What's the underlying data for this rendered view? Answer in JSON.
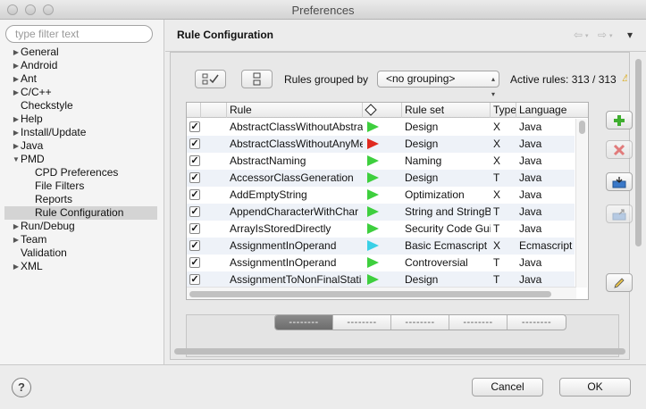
{
  "window": {
    "title": "Preferences"
  },
  "filter": {
    "placeholder": "type filter text",
    "value": ""
  },
  "tree": [
    {
      "label": "General",
      "indent": 0,
      "arrow": "right"
    },
    {
      "label": "Android",
      "indent": 0,
      "arrow": "right"
    },
    {
      "label": "Ant",
      "indent": 0,
      "arrow": "right"
    },
    {
      "label": "C/C++",
      "indent": 0,
      "arrow": "right"
    },
    {
      "label": "Checkstyle",
      "indent": 0,
      "arrow": "none"
    },
    {
      "label": "Help",
      "indent": 0,
      "arrow": "right"
    },
    {
      "label": "Install/Update",
      "indent": 0,
      "arrow": "right"
    },
    {
      "label": "Java",
      "indent": 0,
      "arrow": "right"
    },
    {
      "label": "PMD",
      "indent": 0,
      "arrow": "down"
    },
    {
      "label": "CPD Preferences",
      "indent": 1,
      "arrow": "none"
    },
    {
      "label": "File Filters",
      "indent": 1,
      "arrow": "none"
    },
    {
      "label": "Reports",
      "indent": 1,
      "arrow": "none"
    },
    {
      "label": "Rule Configuration",
      "indent": 1,
      "arrow": "none",
      "selected": true
    },
    {
      "label": "Run/Debug",
      "indent": 0,
      "arrow": "right"
    },
    {
      "label": "Team",
      "indent": 0,
      "arrow": "right"
    },
    {
      "label": "Validation",
      "indent": 0,
      "arrow": "none"
    },
    {
      "label": "XML",
      "indent": 0,
      "arrow": "right"
    }
  ],
  "page": {
    "title": "Rule Configuration",
    "nav_back": "⇦",
    "nav_forward": "⇨",
    "menu": "▾"
  },
  "toolbar": {
    "grouped_label": "Rules grouped by",
    "grouping_value": "<no grouping>",
    "active_rules": "Active rules: 313 / 313"
  },
  "table": {
    "columns": [
      "Rule",
      "Rule set",
      "Type",
      "Language"
    ],
    "rows": [
      {
        "checked": true,
        "rule": "AbstractClassWithoutAbstra",
        "priority_color": "#3ecf3e",
        "ruleset": "Design",
        "type": "X",
        "language": "Java"
      },
      {
        "checked": true,
        "rule": "AbstractClassWithoutAnyMe",
        "priority_color": "#e02a1f",
        "ruleset": "Design",
        "type": "X",
        "language": "Java"
      },
      {
        "checked": true,
        "rule": "AbstractNaming",
        "priority_color": "#3ecf3e",
        "ruleset": "Naming",
        "type": "X",
        "language": "Java"
      },
      {
        "checked": true,
        "rule": "AccessorClassGeneration",
        "priority_color": "#3ecf3e",
        "ruleset": "Design",
        "type": "T",
        "language": "Java"
      },
      {
        "checked": true,
        "rule": "AddEmptyString",
        "priority_color": "#3ecf3e",
        "ruleset": "Optimization",
        "type": "X",
        "language": "Java"
      },
      {
        "checked": true,
        "rule": "AppendCharacterWithChar",
        "priority_color": "#3ecf3e",
        "ruleset": "String and StringB",
        "type": "T",
        "language": "Java"
      },
      {
        "checked": true,
        "rule": "ArrayIsStoredDirectly",
        "priority_color": "#3ecf3e",
        "ruleset": "Security Code Gui",
        "type": "T",
        "language": "Java"
      },
      {
        "checked": true,
        "rule": "AssignmentInOperand",
        "priority_color": "#3ad0e6",
        "ruleset": "Basic Ecmascript",
        "type": "X",
        "language": "Ecmascript"
      },
      {
        "checked": true,
        "rule": "AssignmentInOperand",
        "priority_color": "#3ecf3e",
        "ruleset": "Controversial",
        "type": "T",
        "language": "Java"
      },
      {
        "checked": true,
        "rule": "AssignmentToNonFinalStati",
        "priority_color": "#3ecf3e",
        "ruleset": "Design",
        "type": "T",
        "language": "Java"
      }
    ]
  },
  "tabs": [
    "--------",
    "--------",
    "--------",
    "--------",
    "--------"
  ],
  "footer": {
    "cancel": "Cancel",
    "ok": "OK",
    "help": "?"
  }
}
